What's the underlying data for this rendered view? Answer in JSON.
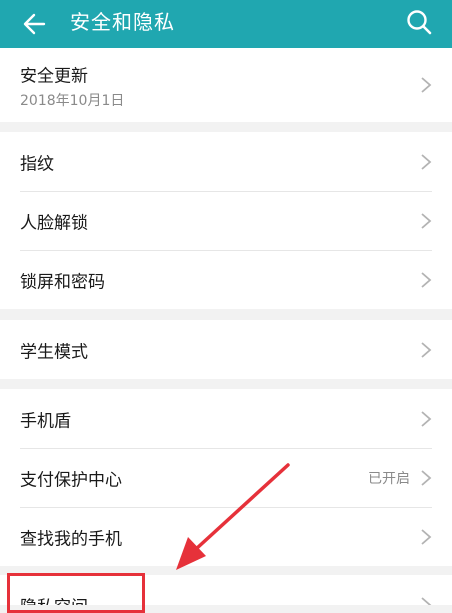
{
  "header": {
    "title": "安全和隐私",
    "accent_color": "#20a7b0"
  },
  "groups": [
    {
      "items": [
        {
          "label": "安全更新",
          "subtitle": "2018年10月1日"
        }
      ]
    },
    {
      "items": [
        {
          "label": "指纹"
        },
        {
          "label": "人脸解锁"
        },
        {
          "label": "锁屏和密码"
        }
      ]
    },
    {
      "items": [
        {
          "label": "学生模式"
        }
      ]
    },
    {
      "items": [
        {
          "label": "手机盾"
        },
        {
          "label": "支付保护中心",
          "status": "已开启"
        },
        {
          "label": "查找我的手机"
        }
      ]
    },
    {
      "items": [
        {
          "label": "隐私空间"
        }
      ]
    }
  ],
  "annotation": {
    "highlight_color": "#e6313a",
    "icon": "red-arrow-icon"
  }
}
